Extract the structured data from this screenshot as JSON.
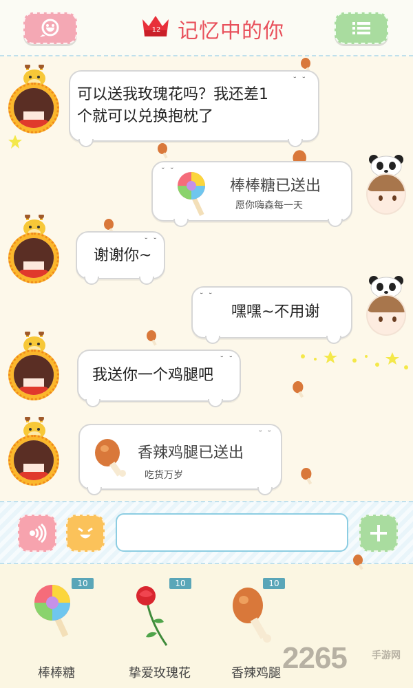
{
  "header": {
    "title": "记忆中的你",
    "level_badge": "12",
    "left_button_icon": "friends-icon",
    "right_button_icon": "menu-icon"
  },
  "messages": [
    {
      "side": "left",
      "type": "text",
      "lines": [
        "可以送我玫瑰花吗？我还差1",
        "个就可以兑换抱枕了"
      ]
    },
    {
      "side": "right",
      "type": "gift",
      "icon": "lollipop-icon",
      "title": "棒棒糖已送出",
      "sub": "愿你嗨森每一天"
    },
    {
      "side": "left",
      "type": "text",
      "lines": [
        "谢谢你~"
      ]
    },
    {
      "side": "right",
      "type": "text",
      "lines": [
        "嘿嘿~不用谢"
      ]
    },
    {
      "side": "left",
      "type": "text",
      "lines": [
        "我送你一个鸡腿吧"
      ]
    },
    {
      "side": "left",
      "type": "gift",
      "icon": "drumstick-icon",
      "title": "香辣鸡腿已送出",
      "sub": "吃货万岁"
    }
  ],
  "input_bar": {
    "voice_icon": "voice-icon",
    "emoji_icon": "emoji-icon",
    "add_icon": "plus-icon",
    "placeholder": ""
  },
  "gifts": [
    {
      "name": "棒棒糖",
      "count": "10",
      "icon": "lollipop-icon"
    },
    {
      "name": "挚爱玫瑰花",
      "count": "10",
      "icon": "rose-icon"
    },
    {
      "name": "香辣鸡腿",
      "count": "10",
      "icon": "drumstick-icon"
    }
  ],
  "watermark": {
    "main": "2265",
    "sub": "手游网"
  },
  "colors": {
    "title": "#e8505b",
    "accent_pink": "#f4a8b4",
    "accent_green": "#a9dc9f",
    "accent_orange": "#fbb72c",
    "input_border": "#8ccde2"
  }
}
